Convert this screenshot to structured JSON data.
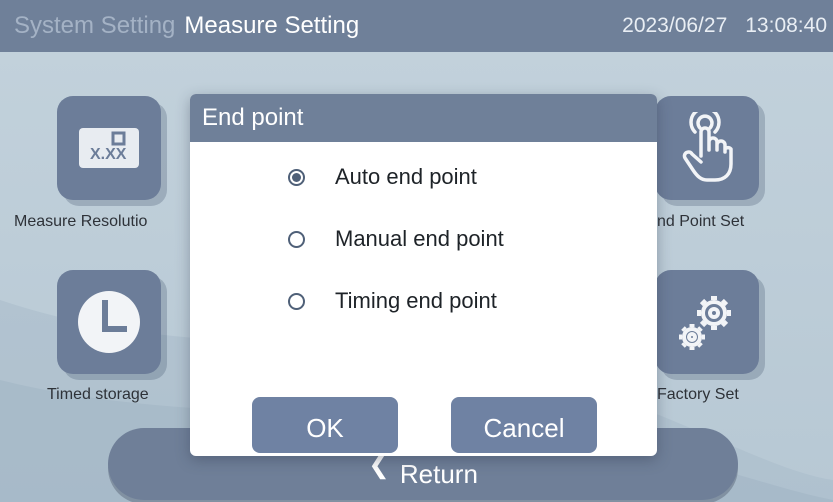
{
  "header": {
    "tab_system": "System Setting",
    "tab_measure": "Measure Setting",
    "date": "2023/06/27",
    "time": "13:08:40"
  },
  "tiles": {
    "measure_resolution": {
      "label": "Measure Resolutio",
      "icon": "resolution-icon",
      "icon_text": "X.XX"
    },
    "end_point_set": {
      "label": "nd Point Set",
      "icon": "touch-hand-icon"
    },
    "timed_storage": {
      "label": "Timed storage",
      "icon": "clock-icon"
    },
    "factory_set": {
      "label": "Factory Set",
      "icon": "gears-icon"
    }
  },
  "return_bar": {
    "label": "Return",
    "icon": "return-arrow-icon"
  },
  "dialog": {
    "title": "End point",
    "options": [
      {
        "label": "Auto end point",
        "selected": true
      },
      {
        "label": "Manual end point",
        "selected": false
      },
      {
        "label": "Timing end point",
        "selected": false
      }
    ],
    "ok_label": "OK",
    "cancel_label": "Cancel"
  },
  "colors": {
    "header_bg": "#6f8099",
    "tile_bg": "#6c7d99",
    "button_bg": "#6f82a3",
    "background": "#b9cad6"
  }
}
